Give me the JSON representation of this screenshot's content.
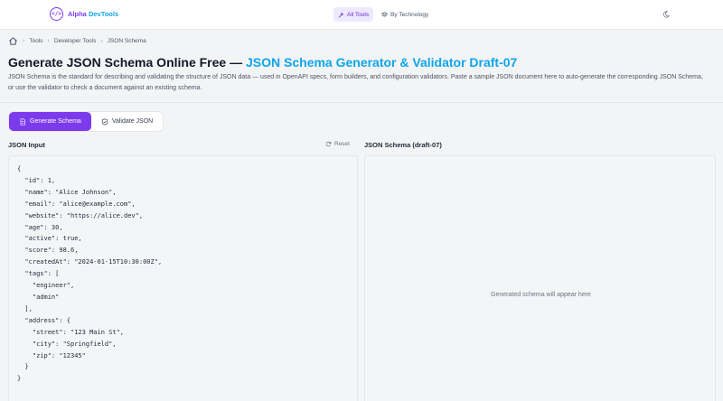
{
  "header": {
    "logo_badge": "</>",
    "logo_part1": "Alpha",
    "logo_part2": "DevTools",
    "nav": [
      {
        "label": "All Tools",
        "icon": "wrench-icon"
      },
      {
        "label": "By Technology",
        "icon": "layers-icon"
      }
    ],
    "theme_icon": "moon-icon"
  },
  "breadcrumb": [
    "Tools",
    "Developer Tools",
    "JSON Schema"
  ],
  "page": {
    "title_main": "Generate JSON Schema Online Free — ",
    "title_accent": "JSON Schema Generator & Validator Draft-07",
    "description": "JSON Schema is the standard for describing and validating the structure of JSON data — used in OpenAPI specs, form builders, and configuration validators. Paste a sample JSON document here to auto-generate the corresponding JSON Schema, or use the validator to check a document against an existing schema."
  },
  "tabs": [
    {
      "label": "Generate Schema",
      "icon": "document-icon",
      "active": true
    },
    {
      "label": "Validate JSON",
      "icon": "shield-check-icon",
      "active": false
    }
  ],
  "input_panel": {
    "label": "JSON Input",
    "reset_label": "Reset",
    "content": "{\n  \"id\": 1,\n  \"name\": \"Alice Johnson\",\n  \"email\": \"alice@example.com\",\n  \"website\": \"https://alice.dev\",\n  \"age\": 30,\n  \"active\": true,\n  \"score\": 98.6,\n  \"createdAt\": \"2024-01-15T10:30:00Z\",\n  \"tags\": [\n    \"engineer\",\n    \"admin\"\n  ],\n  \"address\": {\n    \"street\": \"123 Main St\",\n    \"city\": \"Springfield\",\n    \"zip\": \"12345\"\n  }\n}"
  },
  "output_panel": {
    "label": "JSON Schema (draft-07)",
    "placeholder": "Generated schema will appear here"
  },
  "colors": {
    "accent": "#7c3aed",
    "accent_secondary": "#0ea5e9"
  }
}
